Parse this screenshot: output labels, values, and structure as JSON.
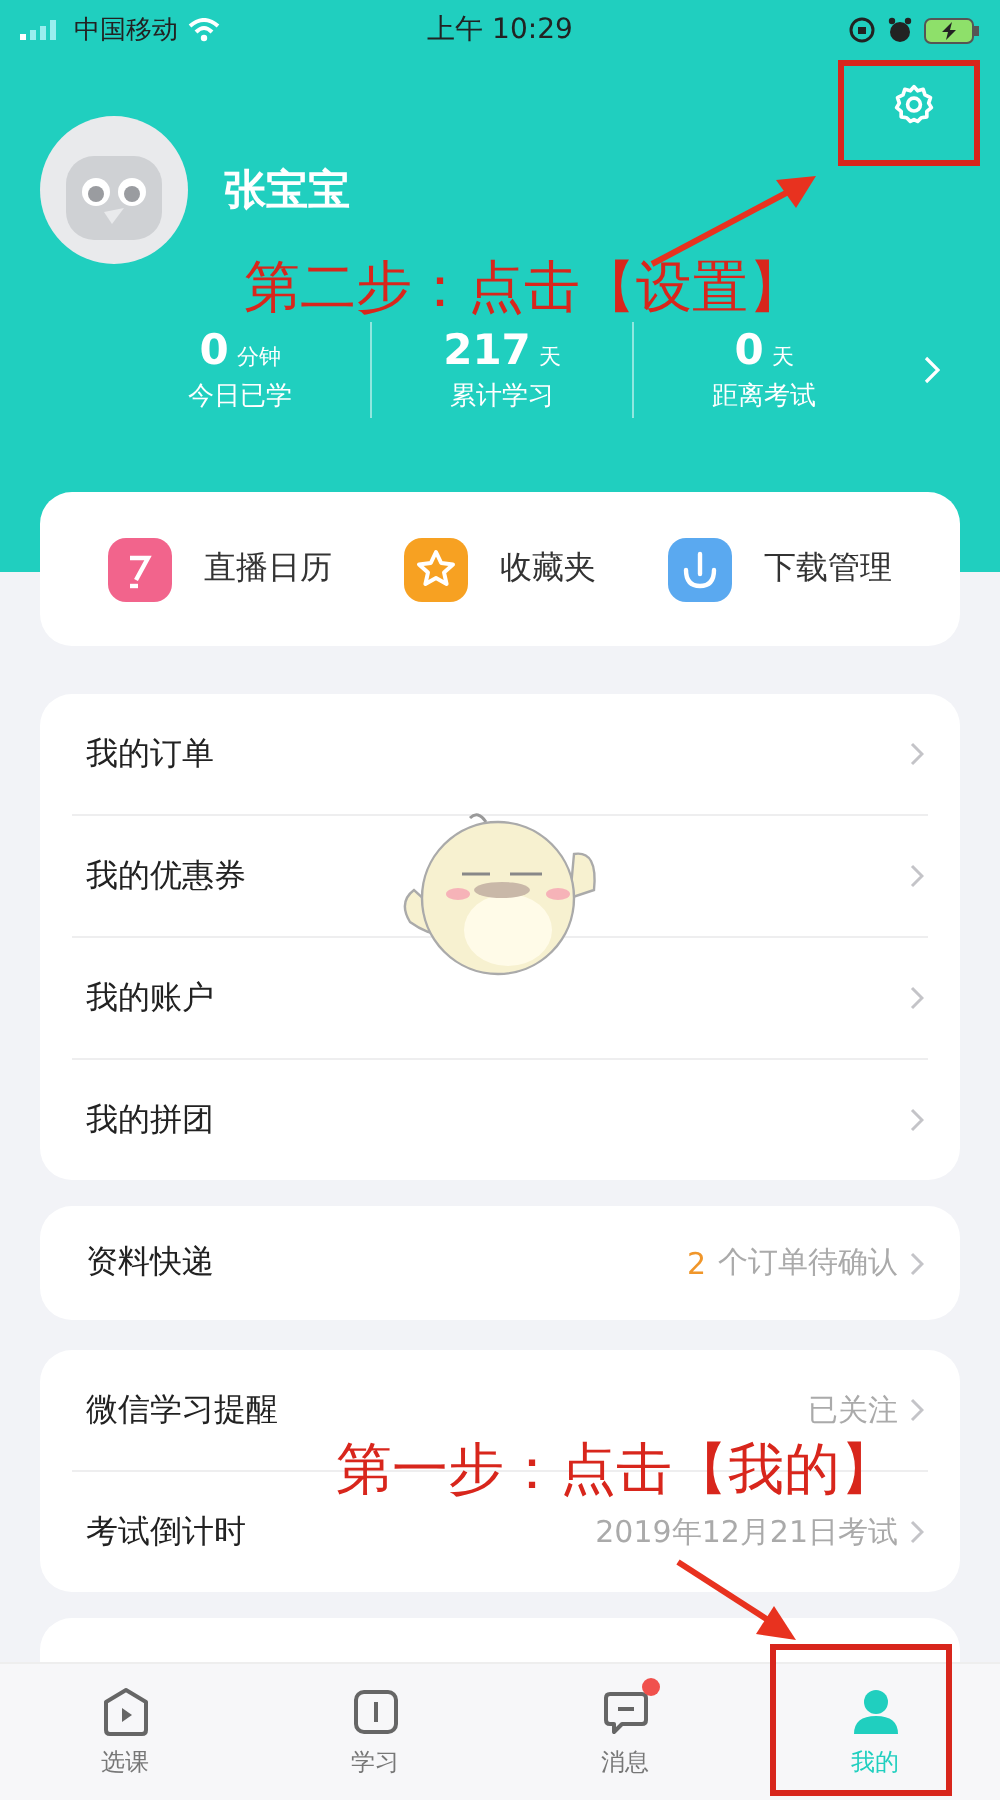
{
  "status_bar": {
    "carrier": "中国移动",
    "time": "上午 10:29"
  },
  "profile": {
    "name": "张宝宝"
  },
  "stats": [
    {
      "value": "0",
      "unit": "分钟",
      "label": "今日已学"
    },
    {
      "value": "217",
      "unit": "天",
      "label": "累计学习"
    },
    {
      "value": "0",
      "unit": "天",
      "label": "距离考试"
    }
  ],
  "shortcuts": [
    {
      "label": "直播日历",
      "kind": "calendar"
    },
    {
      "label": "收藏夹",
      "kind": "favorites"
    },
    {
      "label": "下载管理",
      "kind": "download"
    }
  ],
  "menu_groups": [
    {
      "rows": [
        {
          "label": "我的订单"
        },
        {
          "label": "我的优惠券"
        },
        {
          "label": "我的账户"
        },
        {
          "label": "我的拼团"
        }
      ]
    },
    {
      "rows": [
        {
          "label": "资料快递",
          "count": "2",
          "detail": "个订单待确认"
        }
      ]
    },
    {
      "rows": [
        {
          "label": "微信学习提醒",
          "detail": "已关注"
        },
        {
          "label": "考试倒计时",
          "detail": "2019年12月21日考试"
        }
      ]
    }
  ],
  "tabs": [
    {
      "label": "选课",
      "kind": "courses",
      "selected": false,
      "badge": false
    },
    {
      "label": "学习",
      "kind": "study",
      "selected": false,
      "badge": false
    },
    {
      "label": "消息",
      "kind": "messages",
      "selected": false,
      "badge": true
    },
    {
      "label": "我的",
      "kind": "profile",
      "selected": true,
      "badge": false
    }
  ],
  "annotations": [
    {
      "text": "第二步：点击【设置】"
    },
    {
      "text": "第一步：点击【我的】"
    }
  ]
}
